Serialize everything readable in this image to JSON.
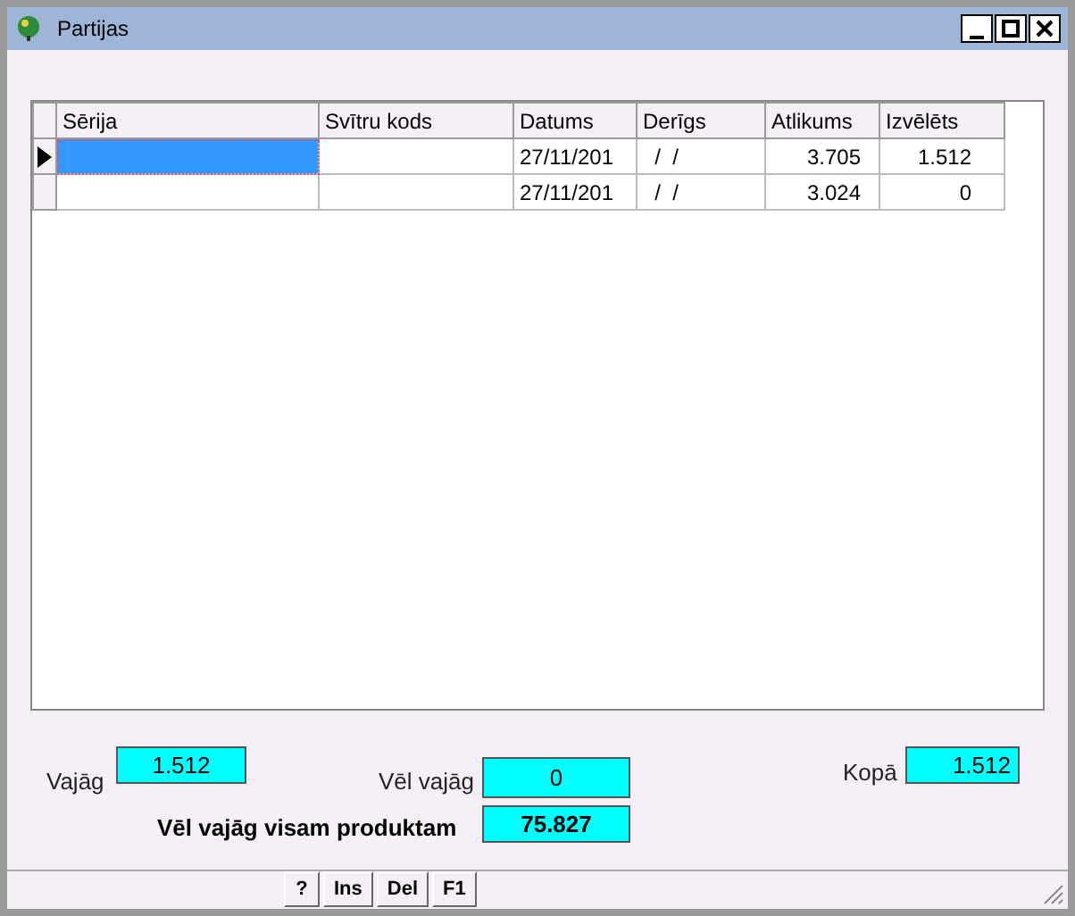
{
  "window": {
    "title": "Partijas"
  },
  "table": {
    "columns": [
      "Sērija",
      "Svītru kods",
      "Datums",
      "Derīgs",
      "Atlikums",
      "Izvēlēts"
    ],
    "rows": [
      {
        "selected": true,
        "cells": [
          "",
          "",
          "27/11/201",
          "  /  /",
          "3.705",
          "1.512"
        ]
      },
      {
        "selected": false,
        "cells": [
          "",
          "",
          "27/11/201",
          "  /  /",
          "3.024",
          "0"
        ]
      }
    ]
  },
  "fields": {
    "vajag": {
      "label": "Vajāg",
      "value": "1.512"
    },
    "vel_vajag": {
      "label": "Vēl vajāg",
      "value": "0"
    },
    "kopa": {
      "label": "Kopā",
      "value": "1.512"
    },
    "vel_vajag_visam": {
      "label": "Vēl vajāg visam produktam",
      "value": "75.827"
    }
  },
  "buttons": [
    "?",
    "Ins",
    "Del",
    "F1"
  ]
}
